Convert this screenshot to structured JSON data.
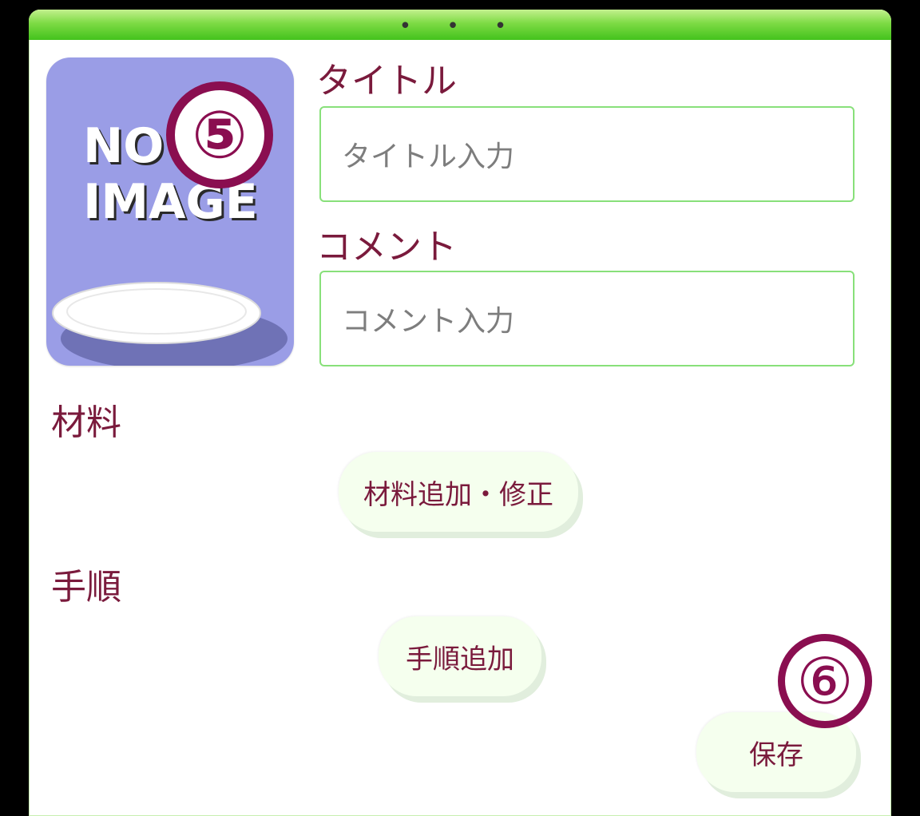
{
  "header": {
    "dots": "• • •"
  },
  "image_placeholder": {
    "text_line1": "NO",
    "text_line2": "IMAGE",
    "badge": "⑤"
  },
  "form": {
    "title_label": "タイトル",
    "title_placeholder": "タイトル入力",
    "comment_label": "コメント",
    "comment_placeholder": "コメント入力"
  },
  "ingredients": {
    "label": "材料",
    "button": "材料追加・修正"
  },
  "steps": {
    "label": "手順",
    "button": "手順追加"
  },
  "save": {
    "button": "保存",
    "badge": "⑥"
  },
  "colors": {
    "header_green": "#43c21c",
    "label_maroon": "#7a1a3c",
    "badge": "#8a0e50",
    "input_border": "#88e07a",
    "placeholder_bg": "#9a9de6"
  }
}
